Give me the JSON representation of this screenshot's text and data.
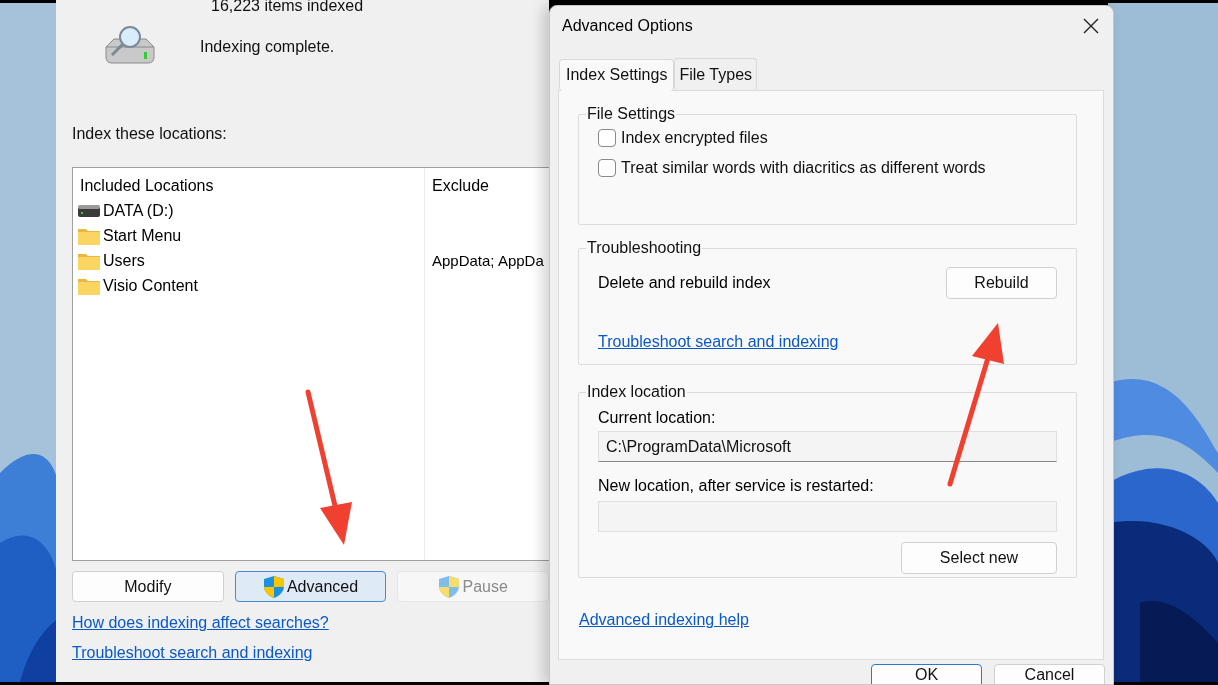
{
  "indexing_window": {
    "status": "16,223 items indexed",
    "message": "Indexing complete.",
    "locations_label": "Index these locations:",
    "table": {
      "columns": [
        "Included Locations",
        "Exclude"
      ],
      "rows": [
        {
          "kind": "drive",
          "location": "DATA (D:)"
        },
        {
          "kind": "folder",
          "location": "Start Menu"
        },
        {
          "kind": "folder",
          "location": "Users",
          "exclude": "AppData; AppDa"
        },
        {
          "kind": "folder",
          "location": "Visio Content"
        }
      ]
    },
    "buttons": [
      {
        "label": "Modify",
        "shield": false,
        "highlighted": false,
        "disabled": false
      },
      {
        "label": "Advanced",
        "shield": true,
        "highlighted": true,
        "disabled": false
      },
      {
        "label": "Pause",
        "shield": true,
        "highlighted": false,
        "disabled": true
      }
    ],
    "links": [
      "How does indexing affect searches?",
      "Troubleshoot search and indexing"
    ]
  },
  "dialog": {
    "title": "Advanced Options",
    "tabs": [
      {
        "label": "Index Settings",
        "selected": true
      },
      {
        "label": "File Types",
        "selected": false
      }
    ],
    "file_settings": {
      "title": "File Settings",
      "checkboxes": [
        {
          "label": "Index encrypted files",
          "checked": false
        },
        {
          "label": "Treat similar words with diacritics as different words",
          "checked": false
        }
      ]
    },
    "troubleshooting": {
      "title": "Troubleshooting",
      "text": "Delete and rebuild index",
      "button": "Rebuild",
      "link": "Troubleshoot search and indexing"
    },
    "index_location": {
      "title": "Index location",
      "current_label": "Current location:",
      "current_value": "C:\\ProgramData\\Microsoft",
      "new_label": "New location, after service is restarted:",
      "button": "Select new"
    },
    "help_link": "Advanced indexing help",
    "buttons": [
      {
        "label": "OK",
        "default": true
      },
      {
        "label": "Cancel",
        "default": false
      }
    ]
  }
}
